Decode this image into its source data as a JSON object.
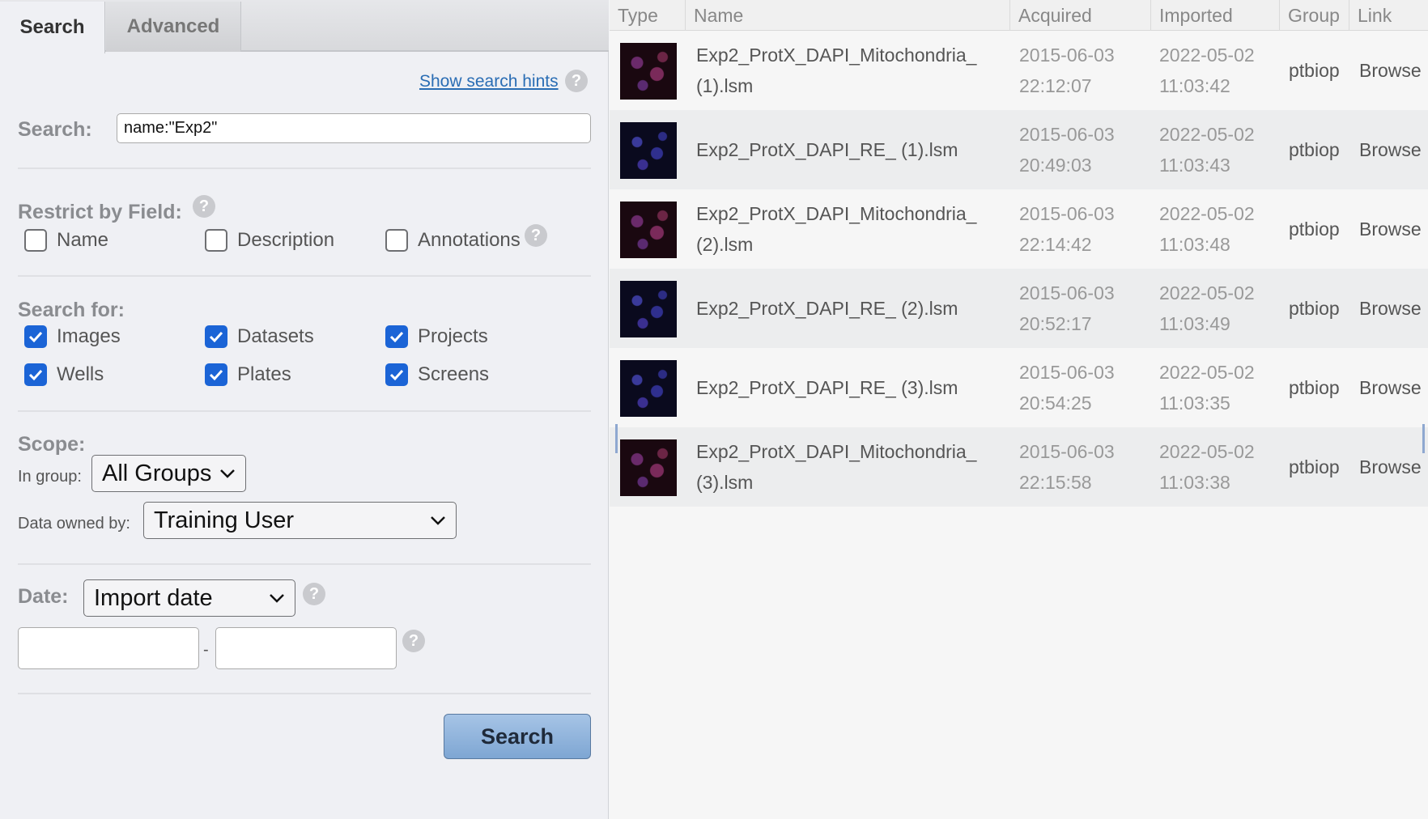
{
  "tabs": [
    {
      "label": "Search",
      "active": true
    },
    {
      "label": "Advanced",
      "active": false
    }
  ],
  "hints_link": "Show search hints",
  "search": {
    "label": "Search:",
    "value": "name:\"Exp2\""
  },
  "restrict": {
    "label": "Restrict by Field:",
    "fields": [
      {
        "label": "Name",
        "checked": false
      },
      {
        "label": "Description",
        "checked": false
      },
      {
        "label": "Annotations",
        "checked": false
      }
    ]
  },
  "search_for": {
    "label": "Search for:",
    "items": [
      {
        "label": "Images",
        "checked": true
      },
      {
        "label": "Datasets",
        "checked": true
      },
      {
        "label": "Projects",
        "checked": true
      },
      {
        "label": "Wells",
        "checked": true
      },
      {
        "label": "Plates",
        "checked": true
      },
      {
        "label": "Screens",
        "checked": true
      }
    ]
  },
  "scope": {
    "label": "Scope:",
    "group_label": "In group:",
    "group_value": "All Groups",
    "owner_label": "Data owned by:",
    "owner_value": "Training User"
  },
  "date": {
    "label": "Date:",
    "type_value": "Import date",
    "separator": "-"
  },
  "search_button": "Search",
  "results": {
    "columns": [
      "Type",
      "Name",
      "Acquired",
      "Imported",
      "Group",
      "Link"
    ],
    "rows": [
      {
        "thumb": "mito",
        "name_line1": "Exp2_ProtX_DAPI_Mitochondria_",
        "name_line2": "(1).lsm",
        "acquired_date": "2015-06-03",
        "acquired_time": "22:12:07",
        "imported_date": "2022-05-02",
        "imported_time": "11:03:42",
        "group": "ptbiop",
        "link": "Browse"
      },
      {
        "thumb": "re",
        "name_line1": "Exp2_ProtX_DAPI_RE_ (1).lsm",
        "name_line2": "",
        "acquired_date": "2015-06-03",
        "acquired_time": "20:49:03",
        "imported_date": "2022-05-02",
        "imported_time": "11:03:43",
        "group": "ptbiop",
        "link": "Browse"
      },
      {
        "thumb": "mito",
        "name_line1": "Exp2_ProtX_DAPI_Mitochondria_",
        "name_line2": "(2).lsm",
        "acquired_date": "2015-06-03",
        "acquired_time": "22:14:42",
        "imported_date": "2022-05-02",
        "imported_time": "11:03:48",
        "group": "ptbiop",
        "link": "Browse"
      },
      {
        "thumb": "re",
        "name_line1": "Exp2_ProtX_DAPI_RE_ (2).lsm",
        "name_line2": "",
        "acquired_date": "2015-06-03",
        "acquired_time": "20:52:17",
        "imported_date": "2022-05-02",
        "imported_time": "11:03:49",
        "group": "ptbiop",
        "link": "Browse"
      },
      {
        "thumb": "re",
        "name_line1": "Exp2_ProtX_DAPI_RE_ (3).lsm",
        "name_line2": "",
        "acquired_date": "2015-06-03",
        "acquired_time": "20:54:25",
        "imported_date": "2022-05-02",
        "imported_time": "11:03:35",
        "group": "ptbiop",
        "link": "Browse"
      },
      {
        "thumb": "mito",
        "name_line1": "Exp2_ProtX_DAPI_Mitochondria_",
        "name_line2": "(3).lsm",
        "acquired_date": "2015-06-03",
        "acquired_time": "22:15:58",
        "imported_date": "2022-05-02",
        "imported_time": "11:03:38",
        "group": "ptbiop",
        "link": "Browse"
      }
    ]
  },
  "colors": {
    "accent": "#1b64d6",
    "link": "#2a6db4",
    "button": "#7ea6d3"
  }
}
